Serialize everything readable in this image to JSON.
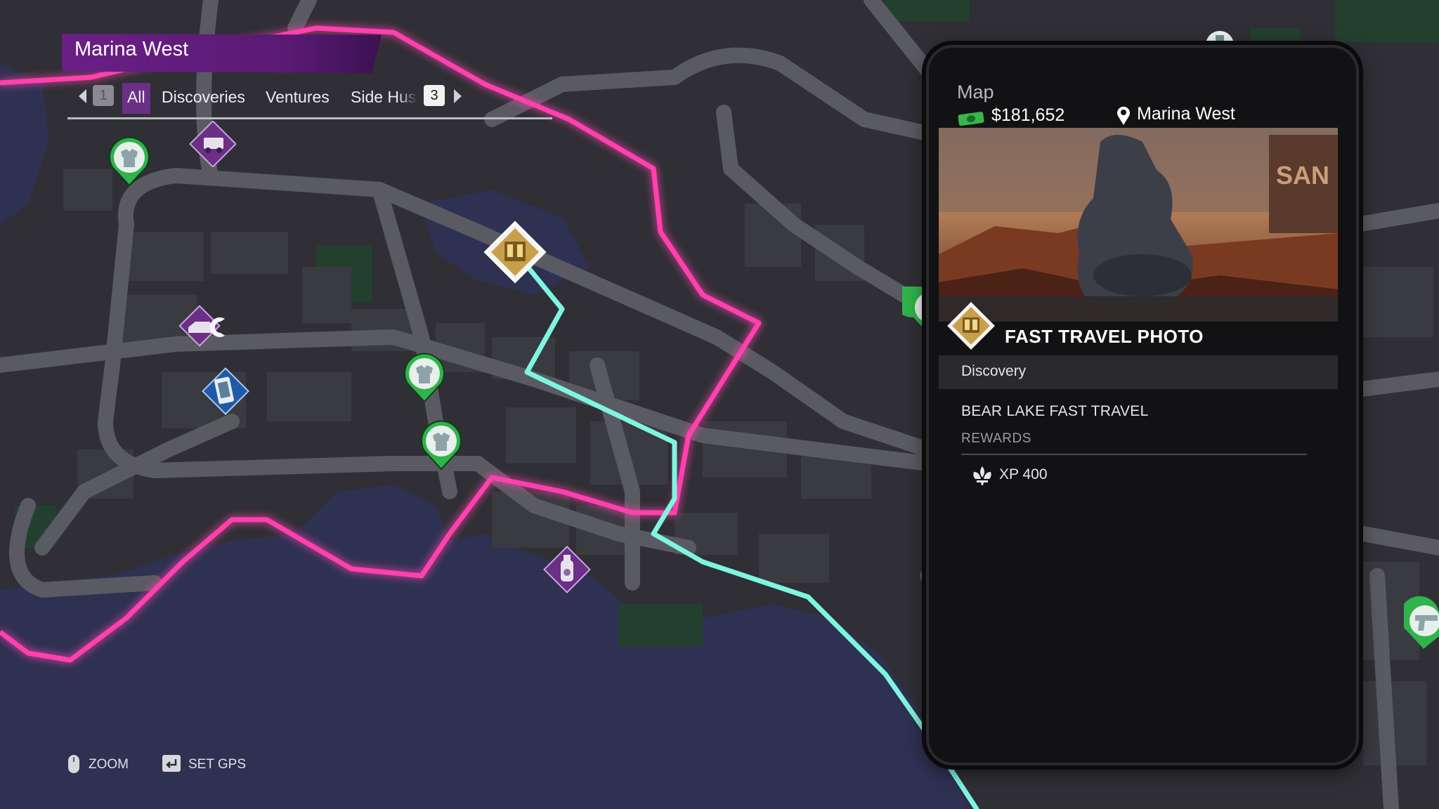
{
  "region": {
    "title": "Marina West"
  },
  "filters": {
    "left_key": "1",
    "right_key": "3",
    "tabs": [
      "All",
      "Discoveries",
      "Ventures",
      "Side Hus"
    ],
    "active": "All"
  },
  "panel": {
    "title": "Map",
    "money": "$181,652",
    "location": "Marina West",
    "photo_title": "FAST TRAVEL PHOTO",
    "category": "Discovery",
    "mission_name": "BEAR LAKE FAST TRAVEL",
    "rewards_label": "REWARDS",
    "reward_xp": "XP 400"
  },
  "controls": {
    "zoom": "ZOOM",
    "set_gps": "SET GPS"
  },
  "map": {
    "markers": [
      "clothing-store-icon",
      "van-venture-icon",
      "fast-travel-icon",
      "vehicle-customization-icon",
      "phone-collectible-icon",
      "clothing-store-icon",
      "clothing-store-icon",
      "spray-can-icon",
      "gun-store-icon",
      "drink-shop-icon"
    ],
    "colors": {
      "district_border": "#ff3fae",
      "gps_route": "#7ff5e0",
      "water": "#2e3152",
      "land": "#2f2f35",
      "road": "#5a5a62"
    }
  }
}
